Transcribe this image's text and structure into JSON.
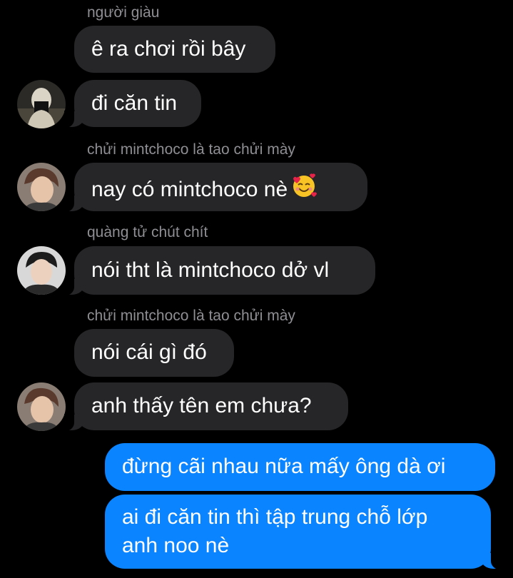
{
  "messages": {
    "m1": {
      "sender": "người giàu",
      "text": "ê ra chơi rồi bây"
    },
    "m2": {
      "text": "đi căn tin"
    },
    "m3": {
      "sender": "chửi mintchoco là tao chửi mày",
      "text": "nay có mintchoco nè"
    },
    "m4": {
      "sender": "quàng tử chút chít",
      "text": "nói tht là mintchoco dở vl"
    },
    "m5": {
      "sender": "chửi mintchoco là tao chửi mày",
      "text": "nói cái gì đó"
    },
    "m6": {
      "text": "anh thấy tên em chưa?"
    },
    "m7": {
      "text": "đừng cãi nhau nữa mấy ông dà ơi"
    },
    "m8": {
      "line1": "ai đi căn tin thì tập trung chỗ lớp",
      "line2": "anh noo nè"
    }
  },
  "icons": {
    "smiling_face_with_hearts": "smiling-face-with-hearts-emoji"
  },
  "colors": {
    "background": "#000000",
    "incoming_bubble": "#262628",
    "outgoing_bubble": "#0a84ff",
    "sender_label": "#8e8e93"
  }
}
